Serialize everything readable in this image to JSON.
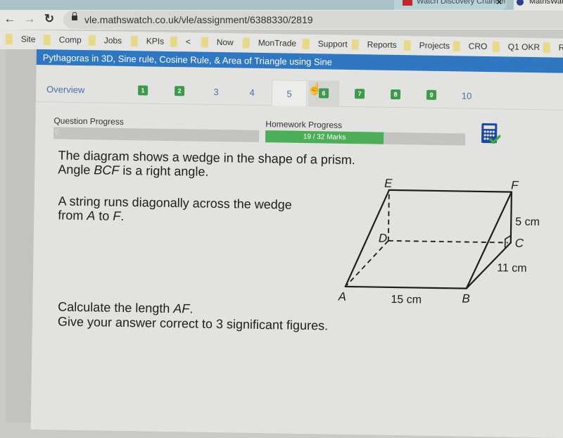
{
  "browser": {
    "tabs": [
      {
        "title": "Watch Discovery Channel",
        "close_icon": "close-icon"
      },
      {
        "title": "MathsWatch"
      }
    ],
    "url": "vle.mathswatch.co.uk/vle/assignment/6388330/2819",
    "nav": {
      "back": "←",
      "forward": "→",
      "reload": "↻"
    },
    "bookmarks": [
      "Site",
      "Comp",
      "Jobs",
      "KPIs",
      "<",
      "Now",
      "MonTrade",
      "Support",
      "Reports",
      "Projects",
      "CRO",
      "Q1 OKR",
      "Ro"
    ]
  },
  "assignment": {
    "title": "Pythagoras in 3D, Sine rule, Cosine Rule, & Area of Triangle using Sine",
    "overview_label": "Overview",
    "questions": [
      {
        "label": "1",
        "completed": true
      },
      {
        "label": "2",
        "completed": true
      },
      {
        "label": "3",
        "completed": false
      },
      {
        "label": "4",
        "completed": false
      },
      {
        "label": "5",
        "completed": false,
        "current": true
      },
      {
        "label": "6",
        "completed": true
      },
      {
        "label": "7",
        "completed": true
      },
      {
        "label": "8",
        "completed": true
      },
      {
        "label": "9",
        "completed": true
      },
      {
        "label": "10",
        "completed": false
      }
    ],
    "question_progress": {
      "label": "Question Progress",
      "value_text": "0",
      "fraction": 0
    },
    "homework_progress": {
      "label": "Homework Progress",
      "value_text": "19 / 32 Marks",
      "marks": 19,
      "total": 32,
      "fraction": 0.59
    },
    "calculator_icon": "calculator-allowed-icon"
  },
  "question": {
    "line1": "The diagram shows a wedge in the shape of a prism.",
    "line2_pre": "Angle ",
    "line2_em": "BCF",
    "line2_post": " is a right angle.",
    "line3": "A string runs diagonally across the wedge",
    "line4_pre": "from ",
    "line4_a": "A",
    "line4_mid": " to ",
    "line4_f": "F",
    "line4_post": ".",
    "line5_pre": "Calculate the length ",
    "line5_em": "AF",
    "line5_post": ".",
    "line6": "Give your answer correct to 3 significant figures."
  },
  "diagram": {
    "vertices": {
      "A": "A",
      "B": "B",
      "C": "C",
      "D": "D",
      "E": "E",
      "F": "F"
    },
    "lengths": {
      "AB": "15 cm",
      "BC": "11 cm",
      "CF": "5 cm"
    }
  }
}
